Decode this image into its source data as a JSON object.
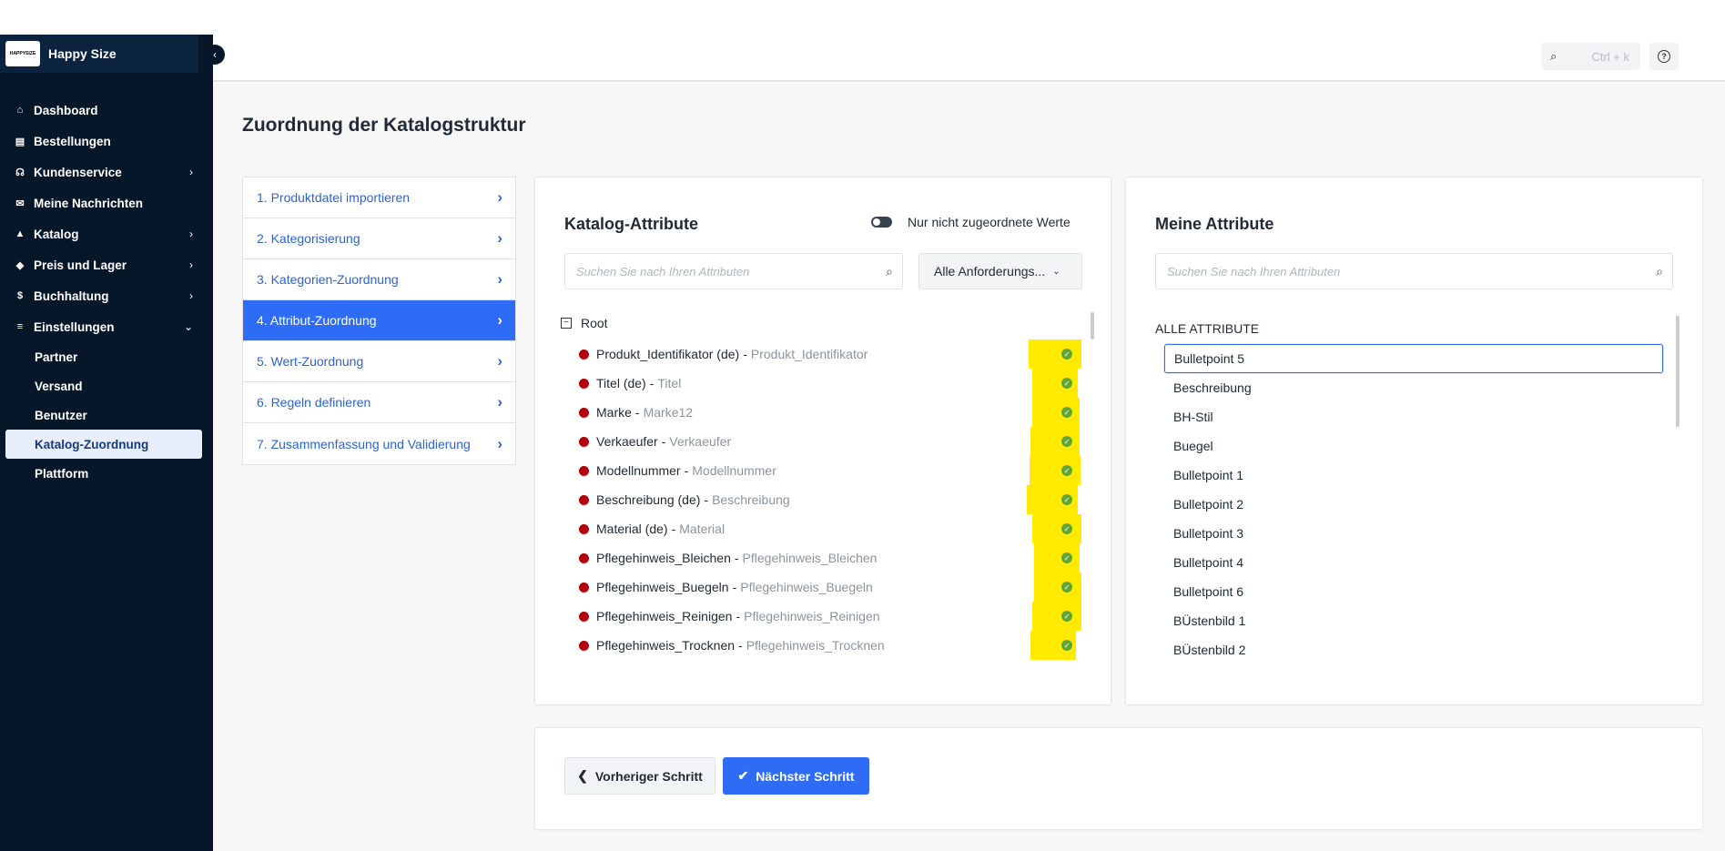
{
  "sidebar": {
    "brand": "Happy Size",
    "logo_text": "HAPPYSIZE",
    "items": [
      {
        "label": "Dashboard",
        "icon": "home-icon",
        "glyph": "⌂",
        "chevron": ""
      },
      {
        "label": "Bestellungen",
        "icon": "clipboard-icon",
        "glyph": "▤",
        "chevron": ""
      },
      {
        "label": "Kundenservice",
        "icon": "headset-icon",
        "glyph": "☊",
        "chevron": "›"
      },
      {
        "label": "Meine Nachrichten",
        "icon": "message-icon",
        "glyph": "✉",
        "chevron": ""
      },
      {
        "label": "Katalog",
        "icon": "shapes-icon",
        "glyph": "▲",
        "chevron": "›"
      },
      {
        "label": "Preis und Lager",
        "icon": "tag-icon",
        "glyph": "◆",
        "chevron": "›"
      },
      {
        "label": "Buchhaltung",
        "icon": "receipt-icon",
        "glyph": "$",
        "chevron": "›"
      },
      {
        "label": "Einstellungen",
        "icon": "sliders-icon",
        "glyph": "≡",
        "chevron": "⌄"
      }
    ],
    "subitems": [
      "Partner",
      "Versand",
      "Benutzer",
      "Katalog-Zuordnung",
      "Plattform"
    ],
    "active_subitem": "Katalog-Zuordnung"
  },
  "topbar": {
    "shortcut": "Ctrl + k"
  },
  "page": {
    "title": "Zuordnung der Katalogstruktur"
  },
  "steps": [
    "1. Produktdatei importieren",
    "2. Kategorisierung",
    "3. Kategorien-Zuordnung",
    "4. Attribut-Zuordnung",
    "5. Wert-Zuordnung",
    "6. Regeln definieren",
    "7. Zusammenfassung und Validierung"
  ],
  "active_step": 3,
  "catalog": {
    "title": "Katalog-Attribute",
    "toggle_label": "Nur nicht zugeordnete Werte",
    "search_placeholder": "Suchen Sie nach Ihren Attributen",
    "filter": "Alle Anforderungs...",
    "root_label": "Root",
    "rows": [
      {
        "name": "Produkt_Identifikator (de)",
        "mapped": "Produkt_Identifikator"
      },
      {
        "name": "Titel (de)",
        "mapped": "Titel"
      },
      {
        "name": "Marke",
        "mapped": "Marke12"
      },
      {
        "name": "Verkaeufer",
        "mapped": "Verkaeufer"
      },
      {
        "name": "Modellnummer",
        "mapped": "Modellnummer"
      },
      {
        "name": "Beschreibung (de)",
        "mapped": "Beschreibung"
      },
      {
        "name": "Material (de)",
        "mapped": "Material"
      },
      {
        "name": "Pflegehinweis_Bleichen",
        "mapped": "Pflegehinweis_Bleichen"
      },
      {
        "name": "Pflegehinweis_Buegeln",
        "mapped": "Pflegehinweis_Buegeln"
      },
      {
        "name": "Pflegehinweis_Reinigen",
        "mapped": "Pflegehinweis_Reinigen"
      },
      {
        "name": "Pflegehinweis_Trocknen",
        "mapped": "Pflegehinweis_Trocknen"
      }
    ],
    "separator": "-",
    "status_color": "#b4000f",
    "highlight_color": "#ffea00"
  },
  "my_attributes": {
    "title": "Meine Attribute",
    "search_placeholder": "Suchen Sie nach Ihren Attributen",
    "section_label": "ALLE ATTRIBUTE",
    "items": [
      "Bulletpoint 5",
      "Beschreibung",
      "BH-Stil",
      "Buegel",
      "Bulletpoint 1",
      "Bulletpoint 2",
      "Bulletpoint 3",
      "Bulletpoint 4",
      "Bulletpoint 6",
      "BÜstenbild 1",
      "BÜstenbild 2"
    ],
    "selected": "Bulletpoint 5"
  },
  "footer": {
    "prev": "Vorheriger Schritt",
    "next": "Nächster Schritt"
  },
  "colors": {
    "accent": "#2e6cf6",
    "sidebar_bg": "#06172a"
  }
}
